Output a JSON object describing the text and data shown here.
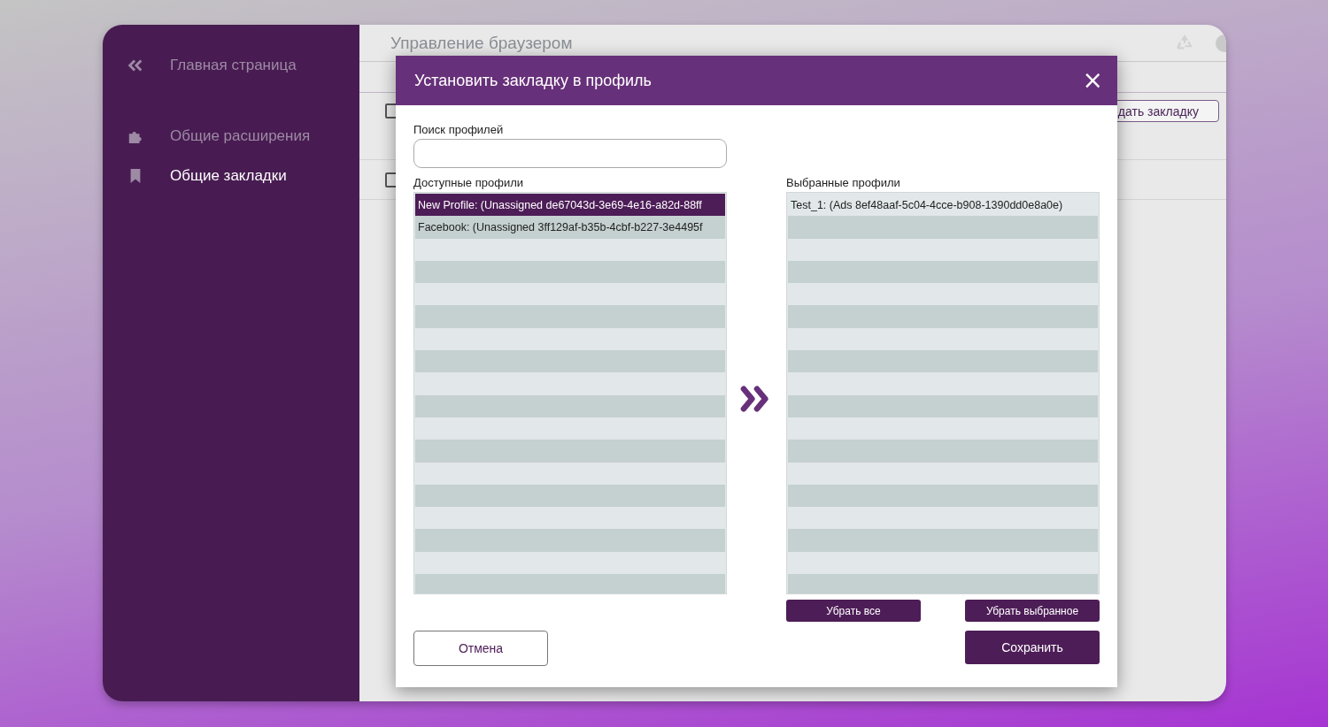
{
  "sidebar": {
    "items": [
      {
        "kind": "back",
        "label": "Главная страница",
        "selected": false
      },
      {
        "kind": "extensions",
        "label": "Общие расширения",
        "selected": false
      },
      {
        "kind": "bookmarks",
        "label": "Общие закладки",
        "selected": true
      }
    ]
  },
  "page": {
    "title": "Управление браузером",
    "rows": [
      {
        "checked": false
      },
      {
        "checked": false
      }
    ],
    "add_button": "дать закладку"
  },
  "dialog": {
    "title": "Установить закладку в профиль",
    "close": "×",
    "search": {
      "label": "Поиск профилей"
    },
    "available": {
      "label": "Доступные профили",
      "items": [
        {
          "text": "New Profile:  (Unassigned  de67043d-3e69-4e16-a82d-88ff",
          "selected": true
        },
        {
          "text": "Facebook:  (Unassigned  3ff129af-b35b-4cbf-b227-3e4495f",
          "selected": false
        }
      ]
    },
    "chosen": {
      "label": "Выбранные профили",
      "items": [
        {
          "text": "Test_1:  (Ads  8ef48aaf-5c04-4cce-b908-1390dd0e8a0e)",
          "selected": false
        }
      ]
    },
    "remove_all": "Убрать все",
    "remove_selected": "Убрать выбранное",
    "cancel": "Отмена",
    "save": "Сохранить"
  }
}
